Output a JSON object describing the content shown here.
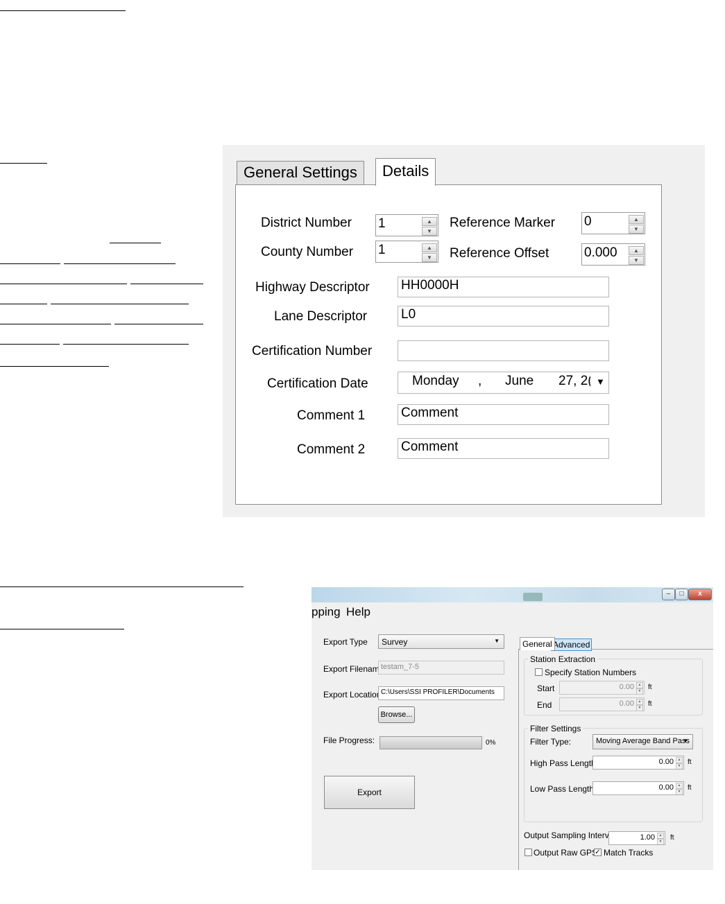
{
  "dialog1": {
    "tabs": [
      {
        "label": "General Settings",
        "active": false
      },
      {
        "label": "Details",
        "active": true
      }
    ],
    "fields": {
      "district_number": {
        "label": "District Number",
        "value": "1"
      },
      "county_number": {
        "label": "County Number",
        "value": "1"
      },
      "reference_marker": {
        "label": "Reference Marker",
        "value": "0"
      },
      "reference_offset": {
        "label": "Reference Offset",
        "value": "0.000"
      },
      "highway_descriptor": {
        "label": "Highway Descriptor",
        "value": "HH0000H"
      },
      "lane_descriptor": {
        "label": "Lane Descriptor",
        "value": "L0"
      },
      "certification_number": {
        "label": "Certification Number",
        "value": ""
      },
      "certification_date": {
        "label": "Certification Date",
        "weekday": "Monday",
        "sep": ",",
        "month": "June",
        "day_year": "27, 2("
      },
      "comment1": {
        "label": "Comment 1",
        "value": "Comment"
      },
      "comment2": {
        "label": "Comment 2",
        "value": "Comment"
      }
    }
  },
  "dialog2": {
    "window_controls": {
      "minimize": "–",
      "maximize": "□",
      "close": "x"
    },
    "menu": [
      "pping",
      "Help"
    ],
    "left": {
      "export_type": {
        "label": "Export Type",
        "value": "Survey"
      },
      "export_filename": {
        "label": "Export Filename",
        "value": "testam_7-5"
      },
      "export_location": {
        "label": "Export Location",
        "value": "C:\\Users\\SSI PROFILER\\Documents"
      },
      "browse_button": "Browse...",
      "file_progress": {
        "label": "File Progress:",
        "percent_text": "0%",
        "fraction": 0
      },
      "export_button": "Export"
    },
    "right": {
      "tabs": [
        {
          "label": "General",
          "active": true
        },
        {
          "label": "Advanced",
          "active": false
        }
      ],
      "station_extraction": {
        "title": "Station Extraction",
        "specify_label": "Specify Station Numbers",
        "specify_checked": false,
        "start": {
          "label": "Start",
          "value": "0.00",
          "unit": "ft"
        },
        "end": {
          "label": "End",
          "value": "0.00",
          "unit": "ft"
        }
      },
      "filter_settings": {
        "title": "Filter Settings",
        "filter_type": {
          "label": "Filter Type:",
          "value": "Moving Average Band Pass"
        },
        "high_pass": {
          "label": "High Pass Length:",
          "value": "0.00",
          "unit": "ft"
        },
        "low_pass": {
          "label": "Low Pass Length:",
          "value": "0.00",
          "unit": "ft"
        }
      },
      "output_sampling": {
        "label": "Output Sampling Interval",
        "value": "1.00",
        "unit": "ft"
      },
      "output_raw_gps": {
        "label": "Output Raw GPS",
        "checked": false
      },
      "match_tracks": {
        "label": "Match Tracks",
        "checked": true
      }
    }
  }
}
